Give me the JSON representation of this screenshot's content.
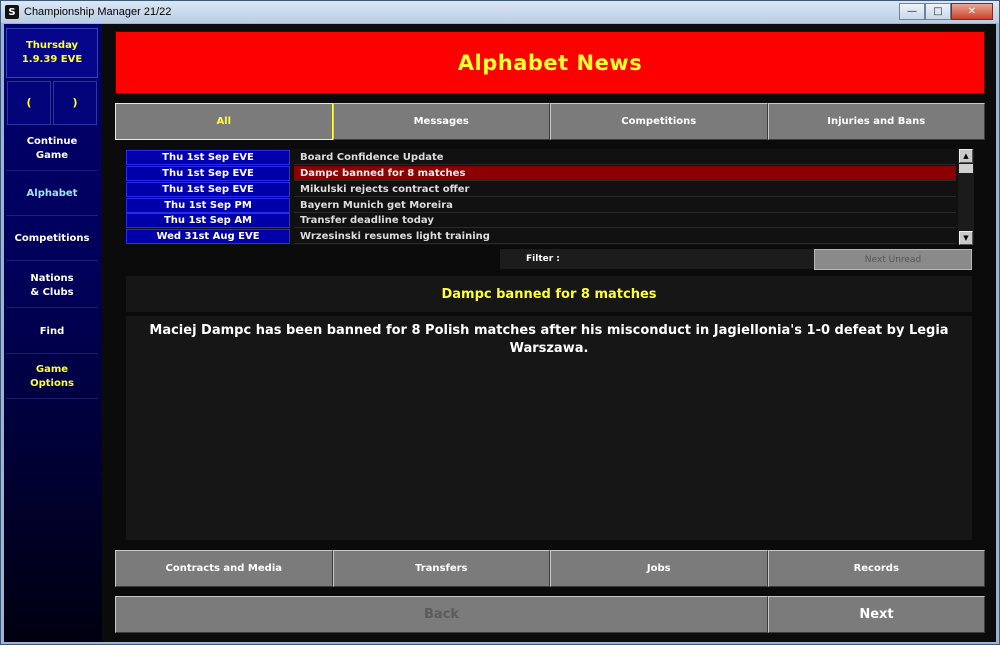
{
  "window": {
    "title": "Championship Manager 21/22",
    "icon_label": "S",
    "controls": {
      "minimize": "—",
      "maximize": "□",
      "close": "✕"
    }
  },
  "sidebar": {
    "date": "Thursday\n1.9.39 EVE",
    "arrows": {
      "prev": "(",
      "next": ")"
    },
    "items": [
      {
        "label": "Continue\nGame",
        "style": "normal"
      },
      {
        "label": "Alphabet",
        "style": "active"
      },
      {
        "label": "Competitions",
        "style": "normal"
      },
      {
        "label": "Nations\n& Clubs",
        "style": "normal"
      },
      {
        "label": "Find",
        "style": "normal"
      },
      {
        "label": "Game\nOptions",
        "style": "yellow"
      }
    ]
  },
  "header": {
    "title": "Alphabet News"
  },
  "top_tabs": [
    {
      "label": "All",
      "selected": true
    },
    {
      "label": "Messages",
      "selected": false
    },
    {
      "label": "Competitions",
      "selected": false
    },
    {
      "label": "Injuries and Bans",
      "selected": false
    }
  ],
  "news": [
    {
      "date": "Thu 1st Sep EVE",
      "headline": "Board Confidence Update",
      "selected": false
    },
    {
      "date": "Thu 1st Sep EVE",
      "headline": "Dampc banned for 8 matches",
      "selected": true
    },
    {
      "date": "Thu 1st Sep EVE",
      "headline": "Mikulski rejects contract offer",
      "selected": false
    },
    {
      "date": "Thu 1st Sep PM",
      "headline": "Bayern Munich get Moreira",
      "selected": false
    },
    {
      "date": "Thu 1st Sep AM",
      "headline": "Transfer deadline today",
      "selected": false
    },
    {
      "date": "Wed 31st Aug EVE",
      "headline": "Wrzesinski resumes light training",
      "selected": false
    }
  ],
  "scrollbar": {
    "up": "▲",
    "down": "▼"
  },
  "filter": {
    "label": "Filter :",
    "value": ""
  },
  "next_unread": "Next Unread",
  "article": {
    "title": "Dampc banned for 8 matches",
    "body": "Maciej Dampc has been banned for 8 Polish matches after his misconduct in Jagiellonia's 1-0 defeat by Legia Warszawa."
  },
  "bottom_tabs": [
    {
      "label": "Contracts and Media"
    },
    {
      "label": "Transfers"
    },
    {
      "label": "Jobs"
    },
    {
      "label": "Records"
    }
  ],
  "nav": {
    "back": "Back",
    "next": "Next"
  },
  "colors": {
    "header_bg": "#ff0000",
    "accent_yellow": "#ffff33",
    "date_cell_bg": "#0000aa",
    "selected_row_bg": "#8b0000",
    "button_grey": "#7b7b7b"
  }
}
